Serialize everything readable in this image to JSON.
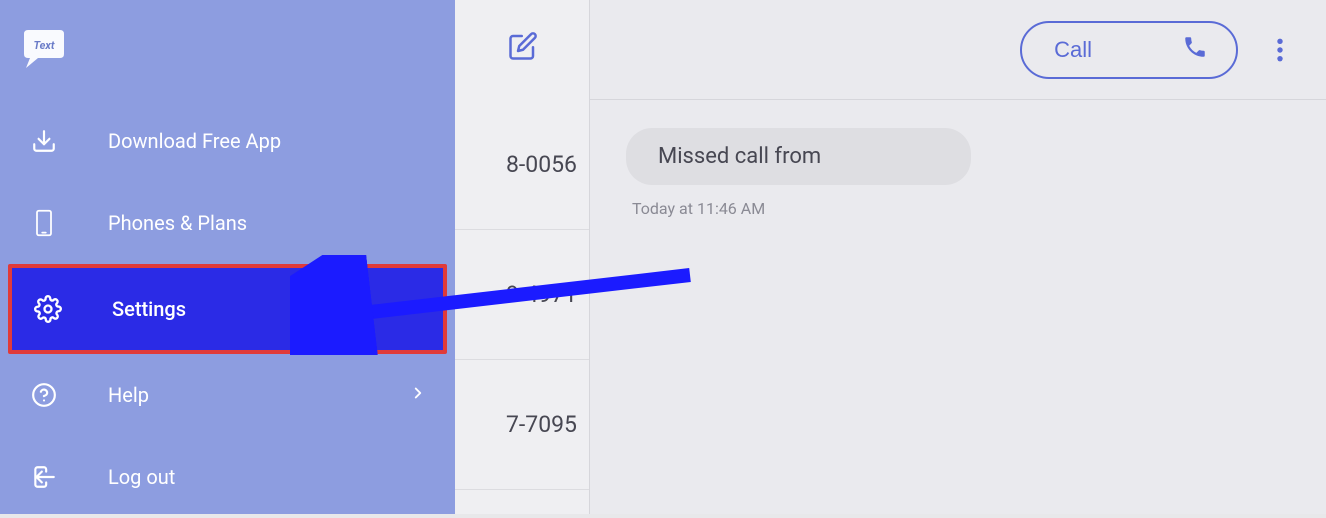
{
  "sidebar": {
    "logo_alt": "TextNow",
    "items": [
      {
        "label": "Download Free App",
        "icon": "download",
        "has_chevron": false
      },
      {
        "label": "Phones & Plans",
        "icon": "phone-device",
        "has_chevron": false
      },
      {
        "label": "Settings",
        "icon": "gear",
        "has_chevron": false,
        "highlighted": true
      },
      {
        "label": "Help",
        "icon": "help-circle",
        "has_chevron": true
      },
      {
        "label": "Log out",
        "icon": "logout",
        "has_chevron": false
      }
    ]
  },
  "conversations": {
    "items": [
      {
        "partial_number": "8-0056"
      },
      {
        "partial_number": "9-4971"
      },
      {
        "partial_number": "7-7095"
      }
    ]
  },
  "chat": {
    "call_button_label": "Call",
    "missed_call_text": "Missed call from",
    "timestamp_text": "Today at 11:46 AM"
  },
  "colors": {
    "accent": "#5a6bd6",
    "sidebar_bg": "#8d9de0",
    "highlight_fill": "#2b2be6",
    "highlight_border": "#e03a3a"
  }
}
